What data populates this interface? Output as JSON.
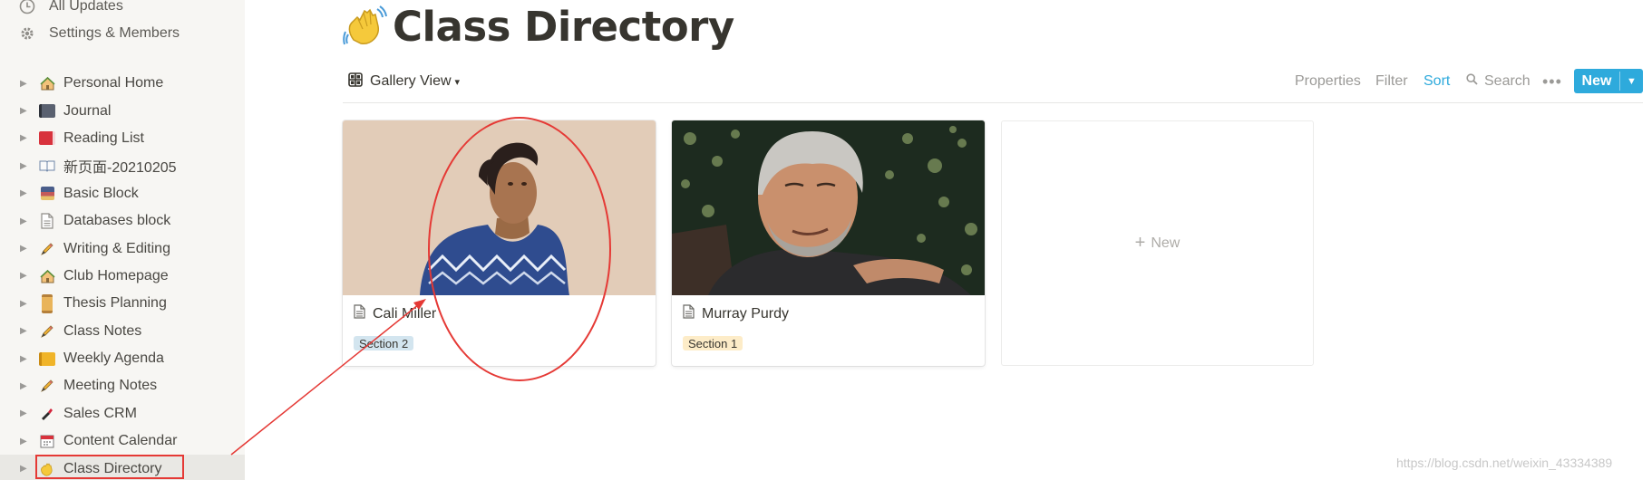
{
  "sidebar": {
    "top_items": [
      {
        "label": "All Updates",
        "icon": "clock-icon"
      },
      {
        "label": "Settings & Members",
        "icon": "gear-icon"
      }
    ],
    "pages": [
      {
        "label": "Personal Home",
        "icon": "house-icon"
      },
      {
        "label": "Journal",
        "icon": "notebook-icon"
      },
      {
        "label": "Reading List",
        "icon": "red-book-icon"
      },
      {
        "label": "新页面-20210205",
        "icon": "open-book-icon"
      },
      {
        "label": "Basic Block",
        "icon": "film-frames-icon"
      },
      {
        "label": "Databases block",
        "icon": "page-icon"
      },
      {
        "label": "Writing & Editing",
        "icon": "pencil-icon"
      },
      {
        "label": "Club Homepage",
        "icon": "house-icon"
      },
      {
        "label": "Thesis Planning",
        "icon": "scroll-icon"
      },
      {
        "label": "Class Notes",
        "icon": "pencil-icon"
      },
      {
        "label": "Weekly Agenda",
        "icon": "ledger-icon"
      },
      {
        "label": "Meeting Notes",
        "icon": "pencil-icon"
      },
      {
        "label": "Sales CRM",
        "icon": "lipstick-icon"
      },
      {
        "label": "Content Calendar",
        "icon": "calendar-icon"
      },
      {
        "label": "Class Directory",
        "icon": "waving-hand-icon",
        "active": true
      }
    ]
  },
  "page": {
    "emoji": "waving-hand-icon",
    "title": "Class Directory"
  },
  "toolbar": {
    "view_label": "Gallery View",
    "properties": "Properties",
    "filter": "Filter",
    "sort": "Sort",
    "search": "Search",
    "more": "•••",
    "new_label": "New"
  },
  "cards": [
    {
      "name": "Cali Miller",
      "tag": "Section 2",
      "tag_color": "#d3e5ef"
    },
    {
      "name": "Murray Purdy",
      "tag": "Section 1",
      "tag_color": "#fdecc8"
    }
  ],
  "new_card_label": "New",
  "watermark": "https://blog.csdn.net/weixin_43334389",
  "colors": {
    "accent": "#2eaadc",
    "annotation": "#e53935",
    "sidebar_bg": "#f7f6f3"
  }
}
